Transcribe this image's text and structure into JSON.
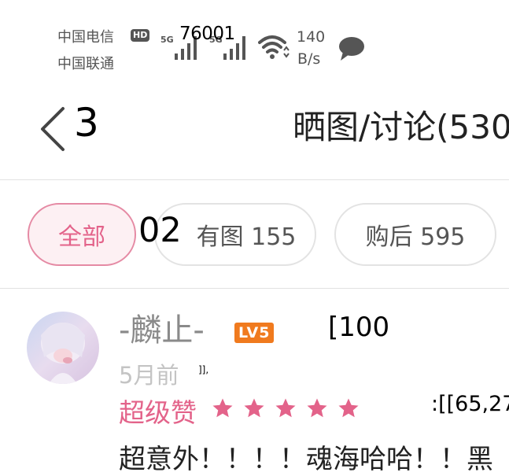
{
  "status_bar": {
    "carrier_1": "中国电信",
    "hd_badge": "HD",
    "carrier_2": "中国联通",
    "network_1": "5G",
    "network_2": "5G",
    "overlay_number": "76001",
    "speed_value": "140",
    "speed_unit": "B/s"
  },
  "header": {
    "back_count": "3",
    "title": "晒图/讨论(530"
  },
  "filter_tabs": [
    {
      "label": "全部",
      "active": true
    },
    {
      "label": "有图 155",
      "active": false
    },
    {
      "label": "购后 595",
      "active": false
    }
  ],
  "overlay_02": "02",
  "review": {
    "username": "-麟止-",
    "level": "LV5",
    "overlay_text": "[100",
    "time": "5月前",
    "overlay_bracket": "]],",
    "rating_label": "超级赞",
    "stars": 5,
    "overlay_coords": ":[[65,27",
    "content": "超意外！！！！魂海哈哈！！黑"
  },
  "colors": {
    "accent_pink": "#e3638a",
    "level_orange": "#f07a1e"
  }
}
